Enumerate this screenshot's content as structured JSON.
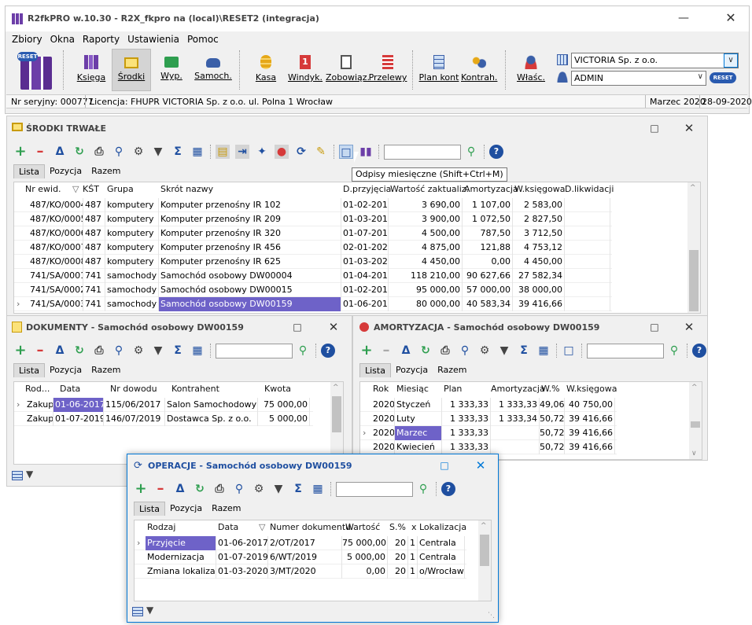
{
  "app": {
    "title": "R2fkPRO w.10.30 - R2X_fkpro na (local)\\RESET2 (integracja)",
    "menu": [
      "Zbiory",
      "Okna",
      "Raporty",
      "Ustawienia",
      "Pomoc"
    ],
    "ribbon": [
      {
        "label": "Księga",
        "icon": "books-icon"
      },
      {
        "label": "Środki",
        "icon": "monitor-icon",
        "active": true
      },
      {
        "label": "Wyp.",
        "icon": "toolbox-icon"
      },
      {
        "label": "Samoch.",
        "icon": "car-icon"
      },
      {
        "label": "Kasa",
        "icon": "coins-icon"
      },
      {
        "label": "Windyk.",
        "icon": "calendar-icon"
      },
      {
        "label": "Zobowiąz.",
        "icon": "payment-icon"
      },
      {
        "label": "Przelewy",
        "icon": "transfer-icon"
      },
      {
        "label": "Plan kont",
        "icon": "table-icon"
      },
      {
        "label": "Kontrah.",
        "icon": "people-icon"
      },
      {
        "label": "Właśc.",
        "icon": "owner-icon"
      }
    ],
    "company": "VICTORIA Sp. z o.o.",
    "user": "ADMIN",
    "status": {
      "serial": "Nr seryjny: 000777",
      "license": "Licencja: FHUPR VICTORIA Sp. z o.o. ul. Polna 1 Wrocław",
      "period": "Marzec 2020",
      "date": "28-09-2020"
    },
    "colors": {
      "accent": "#0078d7",
      "selection": "#6e62c8",
      "green": "#2e9e4f",
      "red": "#d63a3a"
    }
  },
  "srodki": {
    "title": "ŚRODKI TRWAŁE",
    "tabs": [
      "Lista",
      "Pozycja",
      "Razem"
    ],
    "tooltip": "Odpisy miesięczne (Shift+Ctrl+M)",
    "columns": [
      "Nr ewid.",
      "KŚT",
      "Grupa",
      "Skrót nazwy",
      "D.przyjęcia",
      "Wartość zaktualiz.",
      "Amortyzacja",
      "W.księgowa",
      "D.likwidacji"
    ],
    "rows": [
      [
        "487/KO/0004",
        "487",
        "komputery",
        "Komputer przenośny IR 102",
        "01-02-2019",
        "3 690,00",
        "1 107,00",
        "2 583,00",
        ""
      ],
      [
        "487/KO/0005",
        "487",
        "komputery",
        "Komputer przenośny IR 209",
        "01-03-2019",
        "3 900,00",
        "1 072,50",
        "2 827,50",
        ""
      ],
      [
        "487/KO/0006",
        "487",
        "komputery",
        "Komputer przenośny IR 320",
        "01-07-2019",
        "4 500,00",
        "787,50",
        "3 712,50",
        ""
      ],
      [
        "487/KO/0007",
        "487",
        "komputery",
        "Komputer przenośny IR 456",
        "02-01-2020",
        "4 875,00",
        "121,88",
        "4 753,12",
        ""
      ],
      [
        "487/KO/0008",
        "487",
        "komputery",
        "Komputer przenośny IR 625",
        "01-03-2020",
        "4 450,00",
        "0,00",
        "4 450,00",
        ""
      ],
      [
        "741/SA/0001",
        "741",
        "samochody",
        "Samochód osobowy DW00004",
        "01-04-2016",
        "118 210,00",
        "90 627,66",
        "27 582,34",
        ""
      ],
      [
        "741/SA/0002",
        "741",
        "samochody",
        "Samochód osobowy DW00015",
        "01-02-2017",
        "95 000,00",
        "57 000,00",
        "38 000,00",
        ""
      ],
      [
        "741/SA/0003",
        "741",
        "samochody",
        "Samochód osobowy DW00159",
        "01-06-2017",
        "80 000,00",
        "40 583,34",
        "39 416,66",
        ""
      ]
    ]
  },
  "dokumenty": {
    "title": "DOKUMENTY - Samochód osobowy DW00159",
    "tabs": [
      "Lista",
      "Pozycja",
      "Razem"
    ],
    "columns": [
      "Rod...",
      "Data",
      "Nr dowodu",
      "Kontrahent",
      "Kwota"
    ],
    "rows": [
      [
        "Zakup",
        "01-06-2017",
        "115/06/2017",
        "Salon Samochodowy",
        "75 000,00"
      ],
      [
        "Zakup",
        "01-07-2019",
        "146/07/2019",
        "Dostawca Sp. z o.o.",
        "5 000,00"
      ]
    ]
  },
  "amortyzacja": {
    "title": "AMORTYZACJA - Samochód osobowy DW00159",
    "tabs": [
      "Lista",
      "Pozycja",
      "Razem"
    ],
    "columns": [
      "Rok",
      "Miesiąc",
      "Plan",
      "Amortyzacja",
      "W.%",
      "W.księgowa"
    ],
    "rows": [
      [
        "2020",
        "Styczeń",
        "1 333,33",
        "1 333,33",
        "49,06",
        "40 750,00"
      ],
      [
        "2020",
        "Luty",
        "1 333,33",
        "1 333,34",
        "50,72",
        "39 416,66"
      ],
      [
        "2020",
        "Marzec",
        "1 333,33",
        "",
        "50,72",
        "39 416,66"
      ],
      [
        "2020",
        "Kwiecień",
        "1 333,33",
        "",
        "50,72",
        "39 416,66"
      ]
    ]
  },
  "operacje": {
    "title": "OPERACJE - Samochód osobowy DW00159",
    "tabs": [
      "Lista",
      "Pozycja",
      "Razem"
    ],
    "columns": [
      "Rodzaj",
      "Data",
      "Numer dokumentu",
      "Wartość",
      "S.%",
      "x",
      "Lokalizacja"
    ],
    "rows": [
      [
        "Przyjęcie",
        "01-06-2017",
        "2/OT/2017",
        "75 000,00",
        "20",
        "1",
        "Centrala"
      ],
      [
        "Modernizacja",
        "01-07-2019",
        "6/WT/2019",
        "5 000,00",
        "20",
        "1",
        "Centrala"
      ],
      [
        "Zmiana lokalizacji",
        "01-03-2020",
        "3/MT/2020",
        "0,00",
        "20",
        "1",
        "o/Wrocław"
      ]
    ]
  }
}
